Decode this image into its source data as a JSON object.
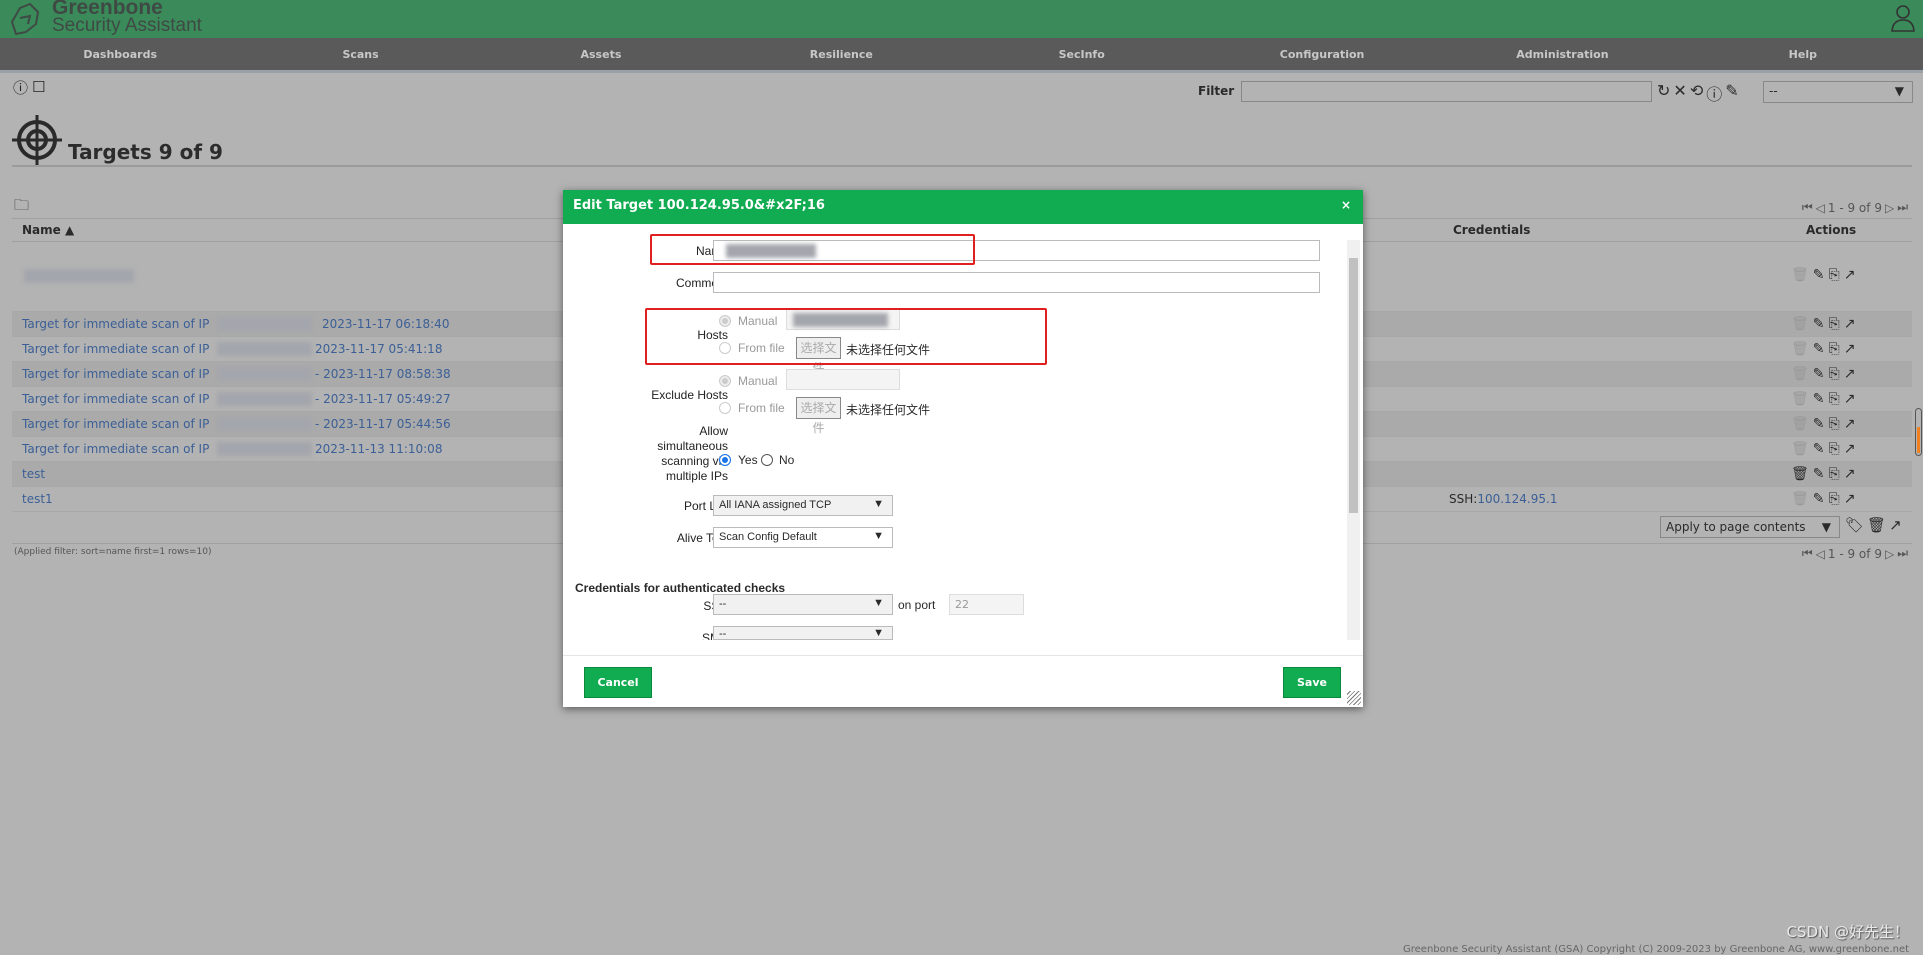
{
  "app": {
    "logo_line1": "Greenbone",
    "logo_line2": "Security Assistant"
  },
  "nav": [
    "Dashboards",
    "Scans",
    "Assets",
    "Resilience",
    "SecInfo",
    "Configuration",
    "Administration",
    "Help"
  ],
  "filter": {
    "label": "Filter",
    "value": "",
    "select_value": "--"
  },
  "page": {
    "title": "Targets 9 of 9",
    "pagination": "1 - 9 of 9",
    "applied_filter": "(Applied filter: sort=name first=1 rows=10)"
  },
  "table": {
    "columns": {
      "name": "Name ▲",
      "credentials": "Credentials",
      "actions": "Actions"
    },
    "rows": [
      {
        "name": "",
        "date": ""
      },
      {
        "name": "Target for immediate scan of IP",
        "date": "2023-11-17 06:18:40"
      },
      {
        "name": "Target for immediate scan of IP",
        "date": "2023-11-17 05:41:18"
      },
      {
        "name": "Target for immediate scan of IP",
        "date": "- 2023-11-17 08:58:38"
      },
      {
        "name": "Target for immediate scan of IP",
        "date": "- 2023-11-17 05:49:27"
      },
      {
        "name": "Target for immediate scan of IP",
        "date": "- 2023-11-17 05:44:56"
      },
      {
        "name": "Target for immediate scan of IP",
        "date": "2023-11-13 11:10:08"
      },
      {
        "name": "test",
        "date": ""
      },
      {
        "name": "test1",
        "date": "",
        "cred_prefix": "SSH:",
        "cred_link": "100.124.95.1"
      }
    ],
    "bulk_select": "Apply to page contents"
  },
  "dialog": {
    "title": "Edit Target 100.124.95.0&#x2F;16",
    "close": "×",
    "labels": {
      "name": "Name",
      "comment": "Comment",
      "hosts": "Hosts",
      "exclude_hosts": "Exclude Hosts",
      "allow": "Allow simultaneous scanning via multiple IPs",
      "port_list": "Port List",
      "alive_test": "Alive Test",
      "creds_heading": "Credentials for authenticated checks",
      "ssh": "SSH",
      "smb": "SMB",
      "on_port": "on port"
    },
    "radio": {
      "manual": "Manual",
      "from_file": "From file",
      "yes": "Yes",
      "no": "No"
    },
    "file_button": "选择文件",
    "no_file": "未选择任何文件",
    "values": {
      "name": "",
      "comment": "",
      "port_list": "All IANA assigned TCP",
      "alive_test": "Scan Config Default",
      "ssh": "--",
      "smb": "--",
      "ssh_port": "22"
    },
    "buttons": {
      "cancel": "Cancel",
      "save": "Save"
    }
  },
  "footer": {
    "copyright": "Greenbone Security Assistant (GSA) Copyright (C) 2009-2023 by Greenbone AG, www.greenbone.net",
    "watermark": "CSDN @好先生！"
  },
  "colors": {
    "header": "#3a8a5a",
    "dialog_header": "#11ab51",
    "highlight": "#e02020",
    "link": "#3b5f96"
  }
}
